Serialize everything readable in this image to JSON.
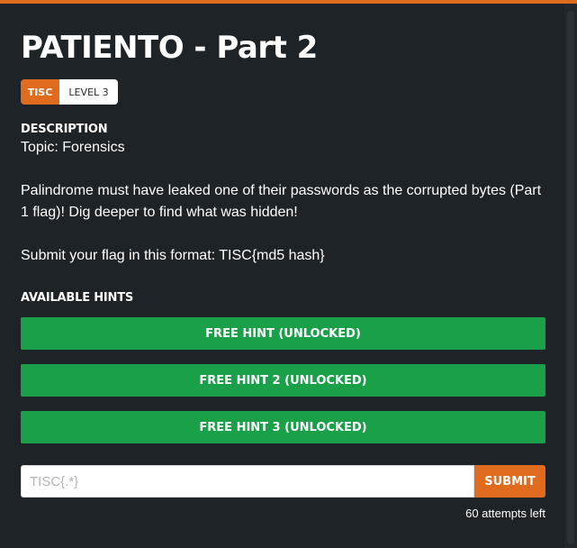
{
  "challenge": {
    "title": "PATIENTO - Part 2",
    "category_tag": "TISC",
    "level": "LEVEL 3"
  },
  "description": {
    "heading": "DESCRIPTION",
    "topic": "Topic: Forensics",
    "body": "Palindrome must have leaked one of their passwords as the corrupted bytes (Part 1 flag)! Dig deeper to find what was hidden!",
    "format": "Submit your flag in this format: TISC{md5 hash}"
  },
  "hints": {
    "heading": "AVAILABLE HINTS",
    "items": [
      {
        "label": "FREE HINT (UNLOCKED)"
      },
      {
        "label": "FREE HINT 2 (UNLOCKED)"
      },
      {
        "label": "FREE HINT 3 (UNLOCKED)"
      }
    ]
  },
  "submission": {
    "placeholder": "TISC{.*}",
    "value": "",
    "submit_label": "SUBMIT",
    "attempts_left": "60 attempts left"
  },
  "colors": {
    "accent": "#e06b1f",
    "hint_green": "#1aa049",
    "background": "#1e2327"
  }
}
